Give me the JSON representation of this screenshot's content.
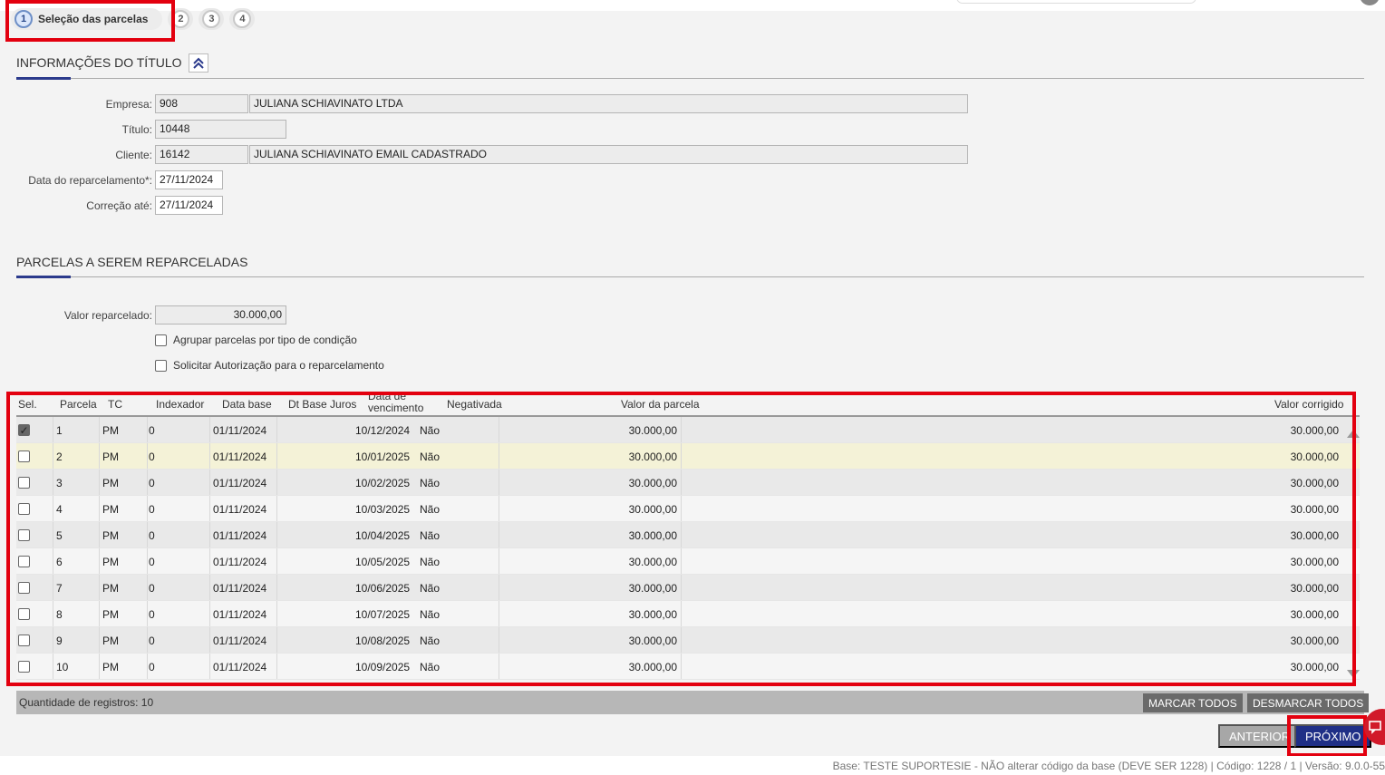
{
  "wizard": {
    "steps": [
      {
        "number": "1",
        "label": "Seleção das parcelas"
      },
      {
        "number": "2"
      },
      {
        "number": "3"
      },
      {
        "number": "4"
      }
    ]
  },
  "titulo_section": {
    "title": "INFORMAÇÕES DO TÍTULO",
    "empresa": {
      "label": "Empresa:",
      "code": "908",
      "name": "JULIANA SCHIAVINATO LTDA"
    },
    "titulo": {
      "label": "Título:",
      "value": "10448"
    },
    "cliente": {
      "label": "Cliente:",
      "code": "16142",
      "name": "JULIANA SCHIAVINATO EMAIL CADASTRADO"
    },
    "data_reparcelamento": {
      "label": "Data do reparcelamento*:",
      "value": "27/11/2024"
    },
    "correcao_ate": {
      "label": "Correção até:",
      "value": "27/11/2024"
    }
  },
  "parcelas_section": {
    "title": "PARCELAS A SEREM REPARCELADAS",
    "valor_reparcelado": {
      "label": "Valor reparcelado:",
      "value": "30.000,00"
    },
    "agrupar_label": "Agrupar parcelas por tipo de condição",
    "solicitar_label": "Solicitar Autorização para o reparcelamento"
  },
  "grid": {
    "headers": {
      "sel": "Sel.",
      "parcela": "Parcela",
      "tc": "TC",
      "indexador": "Indexador",
      "data_base": "Data base",
      "dt_base_juros": "Dt Base Juros",
      "data_vencimento_1": "Data de",
      "data_vencimento_2": "vencimento",
      "negativada": "Negativada",
      "valor_parcela": "Valor da parcela",
      "valor_corrigido": "Valor corrigido"
    },
    "rows": [
      {
        "sel": true,
        "parcela": "1",
        "tc": "PM",
        "indexador": "0",
        "data_base": "01/11/2024",
        "vencimento": "10/12/2024",
        "negativada": "Não",
        "valor": "30.000,00",
        "corrigido": "30.000,00"
      },
      {
        "sel": false,
        "parcela": "2",
        "tc": "PM",
        "indexador": "0",
        "data_base": "01/11/2024",
        "vencimento": "10/01/2025",
        "negativada": "Não",
        "valor": "30.000,00",
        "corrigido": "30.000,00"
      },
      {
        "sel": false,
        "parcela": "3",
        "tc": "PM",
        "indexador": "0",
        "data_base": "01/11/2024",
        "vencimento": "10/02/2025",
        "negativada": "Não",
        "valor": "30.000,00",
        "corrigido": "30.000,00"
      },
      {
        "sel": false,
        "parcela": "4",
        "tc": "PM",
        "indexador": "0",
        "data_base": "01/11/2024",
        "vencimento": "10/03/2025",
        "negativada": "Não",
        "valor": "30.000,00",
        "corrigido": "30.000,00"
      },
      {
        "sel": false,
        "parcela": "5",
        "tc": "PM",
        "indexador": "0",
        "data_base": "01/11/2024",
        "vencimento": "10/04/2025",
        "negativada": "Não",
        "valor": "30.000,00",
        "corrigido": "30.000,00"
      },
      {
        "sel": false,
        "parcela": "6",
        "tc": "PM",
        "indexador": "0",
        "data_base": "01/11/2024",
        "vencimento": "10/05/2025",
        "negativada": "Não",
        "valor": "30.000,00",
        "corrigido": "30.000,00"
      },
      {
        "sel": false,
        "parcela": "7",
        "tc": "PM",
        "indexador": "0",
        "data_base": "01/11/2024",
        "vencimento": "10/06/2025",
        "negativada": "Não",
        "valor": "30.000,00",
        "corrigido": "30.000,00"
      },
      {
        "sel": false,
        "parcela": "8",
        "tc": "PM",
        "indexador": "0",
        "data_base": "01/11/2024",
        "vencimento": "10/07/2025",
        "negativada": "Não",
        "valor": "30.000,00",
        "corrigido": "30.000,00"
      },
      {
        "sel": false,
        "parcela": "9",
        "tc": "PM",
        "indexador": "0",
        "data_base": "01/11/2024",
        "vencimento": "10/08/2025",
        "negativada": "Não",
        "valor": "30.000,00",
        "corrigido": "30.000,00"
      },
      {
        "sel": false,
        "parcela": "10",
        "tc": "PM",
        "indexador": "0",
        "data_base": "01/11/2024",
        "vencimento": "10/09/2025",
        "negativada": "Não",
        "valor": "30.000,00",
        "corrigido": "30.000,00"
      }
    ],
    "footer": {
      "count_label": "Quantidade de registros:",
      "count_value": "10",
      "marcar_todos": "MARCAR TODOS",
      "desmarcar_todos": "DESMARCAR TODOS"
    }
  },
  "actions": {
    "anterior": "ANTERIOR",
    "proximo": "PRÓXIMO"
  },
  "statusbar": {
    "text": "Base: TESTE SUPORTESIE - NÃO alterar código da base (DEVE SER 1228) | Código: 1228 / 1 | Versão: 9.0.0-55"
  },
  "colors": {
    "accent_navy": "#1f2f86",
    "highlight_red": "#e3000f",
    "hover_row": "#f4f2d7"
  }
}
